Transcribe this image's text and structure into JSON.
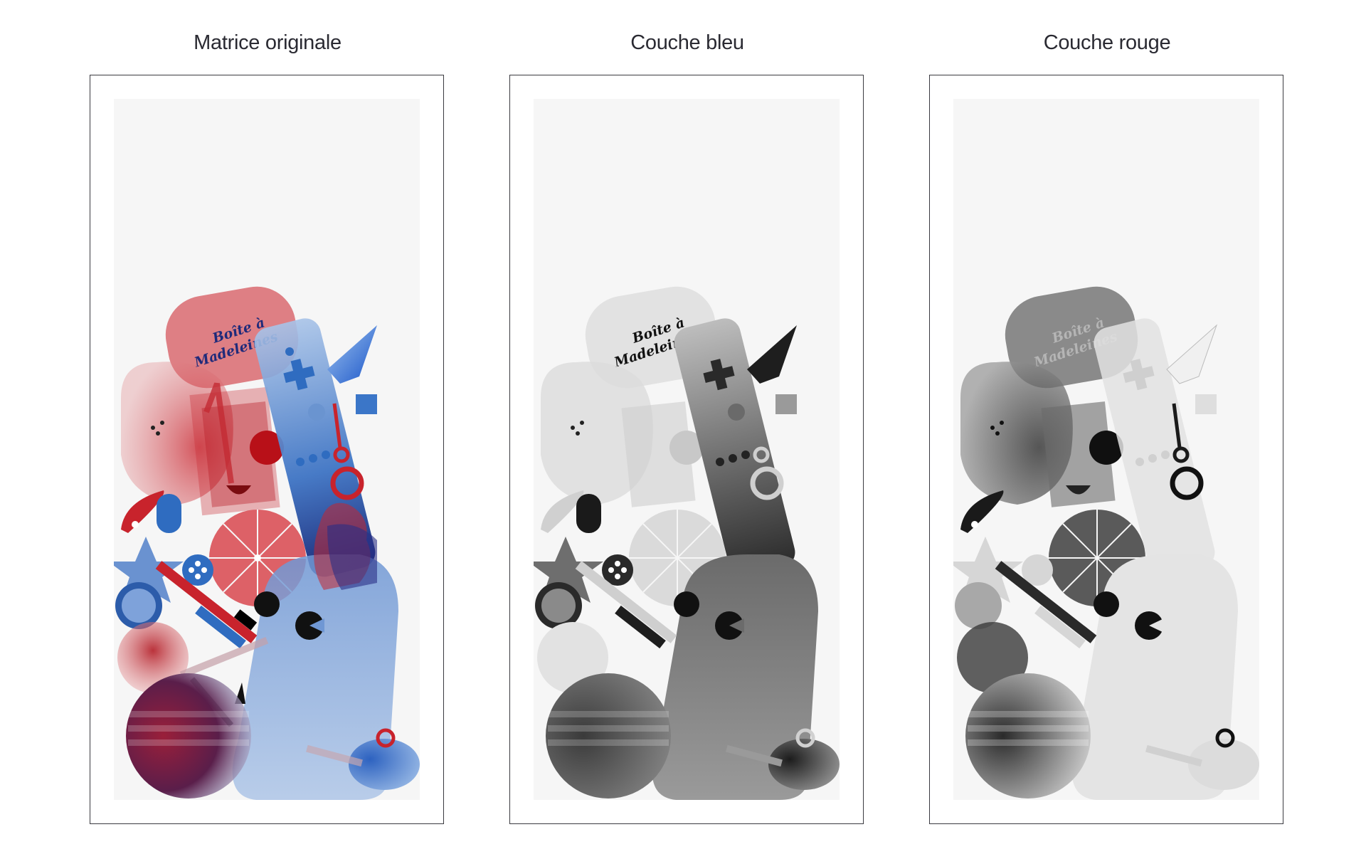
{
  "panels": [
    {
      "title": "Matrice originale",
      "mode": "original"
    },
    {
      "title": "Couche bleu",
      "mode": "blue"
    },
    {
      "title": "Couche rouge",
      "mode": "red"
    }
  ],
  "artwork": {
    "label_line_1": "Boîte à",
    "label_line_2": "Madeleines"
  },
  "colors": {
    "red": "#c8232c",
    "blue": "#2f6cc0",
    "navy": "#1f2a7a",
    "canvas_bg": "#f6f6f6",
    "frame_border": "#3a3a40"
  }
}
